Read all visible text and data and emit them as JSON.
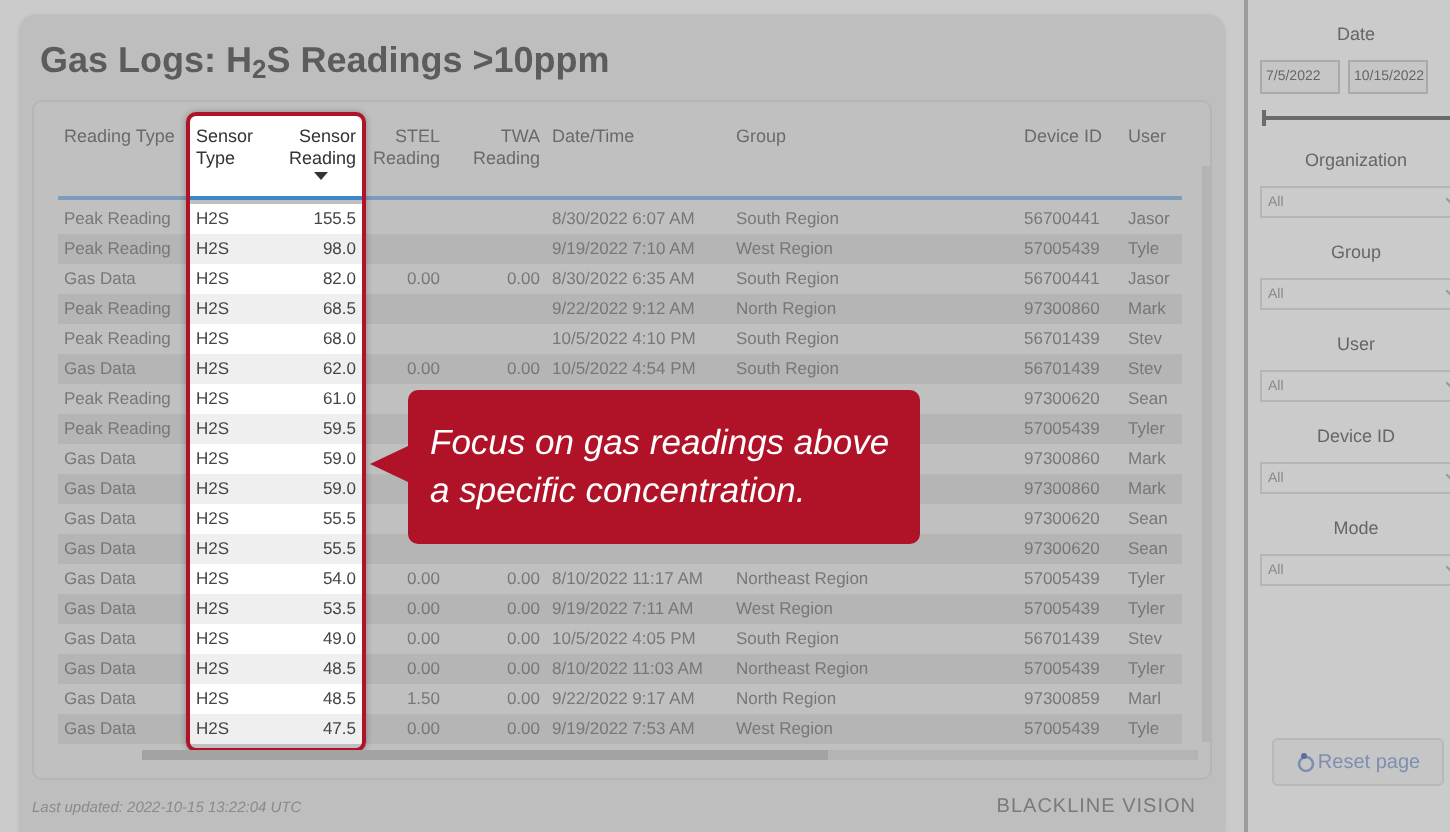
{
  "title": "Gas Logs: H$_{2}$S Readings >10ppm",
  "table": {
    "columns": [
      {
        "label": "Reading Type",
        "highlighted": false,
        "sorted": false
      },
      {
        "label": "Sensor Type",
        "highlighted": true,
        "sorted": false
      },
      {
        "label": "Sensor Reading",
        "highlighted": true,
        "sorted": true
      },
      {
        "label": "STEL Reading",
        "highlighted": false,
        "sorted": false
      },
      {
        "label": "TWA Reading",
        "highlighted": false,
        "sorted": false
      },
      {
        "label": "Date/Time",
        "highlighted": false,
        "sorted": false
      },
      {
        "label": "Group",
        "highlighted": false,
        "sorted": false
      },
      {
        "label": "Device ID",
        "highlighted": false,
        "sorted": false
      },
      {
        "label": "User",
        "highlighted": false,
        "sorted": false
      }
    ],
    "rows": [
      {
        "reading_type": "Peak Reading",
        "sensor_type": "H2S",
        "sensor_reading": "155.5",
        "date_time": "8/30/2022 6:07 AM",
        "group": "South Region",
        "device_id": "56700441",
        "user": "Jasor"
      },
      {
        "reading_type": "Peak Reading",
        "sensor_type": "H2S",
        "sensor_reading": "98.0",
        "date_time": "9/19/2022 7:10 AM",
        "group": "West Region",
        "device_id": "57005439",
        "user": "Tyle"
      },
      {
        "reading_type": "Gas Data",
        "sensor_type": "H2S",
        "sensor_reading": "82.0",
        "stel": "0.00",
        "twa": "0.00",
        "date_time": "8/30/2022 6:35 AM",
        "group": "South Region",
        "device_id": "56700441",
        "user": "Jasor"
      },
      {
        "reading_type": "Peak Reading",
        "sensor_type": "H2S",
        "sensor_reading": "68.5",
        "date_time": "9/22/2022 9:12 AM",
        "group": "North Region",
        "device_id": "97300860",
        "user": "Mark"
      },
      {
        "reading_type": "Peak Reading",
        "sensor_type": "H2S",
        "sensor_reading": "68.0",
        "date_time": "10/5/2022 4:10 PM",
        "group": "South Region",
        "device_id": "56701439",
        "user": "Stev"
      },
      {
        "reading_type": "Gas Data",
        "sensor_type": "H2S",
        "sensor_reading": "62.0",
        "stel": "0.00",
        "twa": "0.00",
        "date_time": "10/5/2022 4:54 PM",
        "group": "South Region",
        "device_id": "56701439",
        "user": "Stev"
      },
      {
        "reading_type": "Peak Reading",
        "sensor_type": "H2S",
        "sensor_reading": "61.0",
        "device_id": "97300620",
        "user": "Sean"
      },
      {
        "reading_type": "Peak Reading",
        "sensor_type": "H2S",
        "sensor_reading": "59.5",
        "device_id": "57005439",
        "user": "Tyler"
      },
      {
        "reading_type": "Gas Data",
        "sensor_type": "H2S",
        "sensor_reading": "59.0",
        "device_id": "97300860",
        "user": "Mark"
      },
      {
        "reading_type": "Gas Data",
        "sensor_type": "H2S",
        "sensor_reading": "59.0",
        "device_id": "97300860",
        "user": "Mark"
      },
      {
        "reading_type": "Gas Data",
        "sensor_type": "H2S",
        "sensor_reading": "55.5",
        "device_id": "97300620",
        "user": "Sean"
      },
      {
        "reading_type": "Gas Data",
        "sensor_type": "H2S",
        "sensor_reading": "55.5",
        "device_id": "97300620",
        "user": "Sean"
      },
      {
        "reading_type": "Gas Data",
        "sensor_type": "H2S",
        "sensor_reading": "54.0",
        "stel": "0.00",
        "twa": "0.00",
        "date_time": "8/10/2022 11:17 AM",
        "group": "Northeast Region",
        "device_id": "57005439",
        "user": "Tyler"
      },
      {
        "reading_type": "Gas Data",
        "sensor_type": "H2S",
        "sensor_reading": "53.5",
        "stel": "0.00",
        "twa": "0.00",
        "date_time": "9/19/2022 7:11 AM",
        "group": "West Region",
        "device_id": "57005439",
        "user": "Tyler"
      },
      {
        "reading_type": "Gas Data",
        "sensor_type": "H2S",
        "sensor_reading": "49.0",
        "stel": "0.00",
        "twa": "0.00",
        "date_time": "10/5/2022 4:05 PM",
        "group": "South Region",
        "device_id": "56701439",
        "user": "Stev"
      },
      {
        "reading_type": "Gas Data",
        "sensor_type": "H2S",
        "sensor_reading": "48.5",
        "stel": "0.00",
        "twa": "0.00",
        "date_time": "8/10/2022 11:03 AM",
        "group": "Northeast Region",
        "device_id": "57005439",
        "user": "Tyler"
      },
      {
        "reading_type": "Gas Data",
        "sensor_type": "H2S",
        "sensor_reading": "48.5",
        "stel": "1.50",
        "twa": "0.00",
        "date_time": "9/22/2022 9:17 AM",
        "group": "North Region",
        "device_id": "97300859",
        "user": "Marl"
      },
      {
        "reading_type": "Gas Data",
        "sensor_type": "H2S",
        "sensor_reading": "47.5",
        "stel": "0.00",
        "twa": "0.00",
        "date_time": "9/19/2022 7:53 AM",
        "group": "West Region",
        "device_id": "57005439",
        "user": "Tyle"
      }
    ]
  },
  "callout": {
    "text": "Focus on gas readings above a specific concentration."
  },
  "footer": {
    "updated": "Last updated: 2022-10-15 13:22:04 UTC",
    "logo": "BLACKLINE VISION"
  },
  "filters": [
    {
      "kind": "date_range",
      "label": "Date",
      "from": "7/5/2022",
      "to": "10/15/2022",
      "level": 1
    },
    {
      "kind": "dropdown",
      "label": "Organization",
      "value": "All"
    },
    {
      "kind": "dropdown",
      "label": "Group",
      "value": "All"
    },
    {
      "kind": "dropdown",
      "label": "User",
      "value": "All"
    },
    {
      "kind": "dropdown",
      "label": "Device ID",
      "value": "All"
    },
    {
      "kind": "dropdown",
      "label": "Mode",
      "value": "All"
    }
  ],
  "reset_button": "Reset page"
}
